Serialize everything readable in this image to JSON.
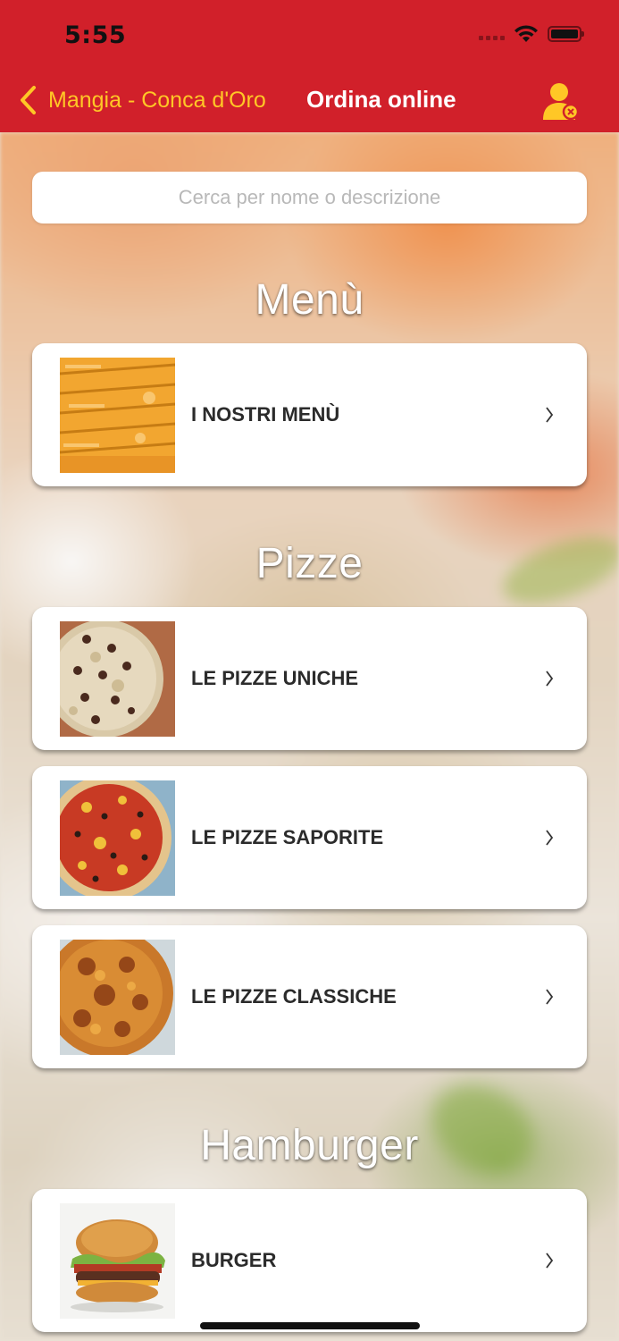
{
  "status_bar": {
    "time": "5:55"
  },
  "nav": {
    "back_label": "Mangia - Conca d'Oro",
    "title": "Ordina online"
  },
  "search": {
    "placeholder": "Cerca per nome o descrizione",
    "value": ""
  },
  "sections": [
    {
      "title": "Menù",
      "items": [
        {
          "label": "I NOSTRI MENÙ",
          "image": "pizza-boxes"
        }
      ]
    },
    {
      "title": "Pizze",
      "items": [
        {
          "label": "LE PIZZE UNICHE",
          "image": "pizza-unica"
        },
        {
          "label": "LE PIZZE SAPORITE",
          "image": "pizza-saporita"
        },
        {
          "label": "LE PIZZE CLASSICHE",
          "image": "pizza-classica"
        }
      ]
    },
    {
      "title": "Hamburger",
      "items": [
        {
          "label": "BURGER",
          "image": "burger"
        }
      ]
    }
  ],
  "colors": {
    "nav_bg": "#d1202a",
    "accent": "#ffc726",
    "card_text": "#2b2b2b"
  }
}
